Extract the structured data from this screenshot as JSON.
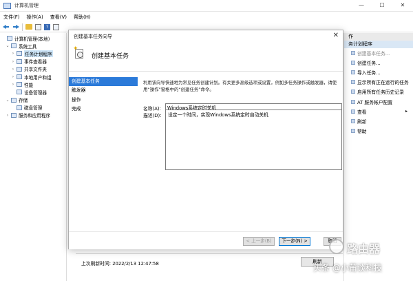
{
  "window": {
    "title": "计算机管理",
    "controls": [
      "—",
      "☐",
      "✕"
    ]
  },
  "menubar": [
    "文件(F)",
    "操作(A)",
    "查看(V)",
    "帮助(H)"
  ],
  "tree": [
    {
      "label": "计算机管理(本地)",
      "level": 0,
      "chev": ""
    },
    {
      "label": "系统工具",
      "level": 1,
      "chev": "⌄"
    },
    {
      "label": "任务计划程序",
      "level": 2,
      "chev": "›",
      "selected": true
    },
    {
      "label": "事件查看器",
      "level": 2,
      "chev": "›"
    },
    {
      "label": "共享文件夹",
      "level": 2,
      "chev": "›"
    },
    {
      "label": "本地用户和组",
      "level": 2,
      "chev": "›"
    },
    {
      "label": "性能",
      "level": 2,
      "chev": "›"
    },
    {
      "label": "设备管理器",
      "level": 2,
      "chev": ""
    },
    {
      "label": "存储",
      "level": 1,
      "chev": "⌄"
    },
    {
      "label": "磁盘管理",
      "level": 2,
      "chev": ""
    },
    {
      "label": "服务和应用程序",
      "level": 1,
      "chev": "›"
    }
  ],
  "actions": {
    "header": "作",
    "subheader": "务计划程序",
    "items": [
      {
        "label": "创建基本任务...",
        "disabled": true
      },
      {
        "label": "创建任务...",
        "disabled": false
      },
      {
        "label": "导入任务...",
        "disabled": false
      },
      {
        "label": "显示所有正在运行的任务",
        "disabled": false
      },
      {
        "label": "启用所有任务历史记录",
        "disabled": false
      },
      {
        "label": "AT 服务帐户配置",
        "disabled": false
      },
      {
        "label": "查看",
        "disabled": false,
        "submenu": "▸"
      },
      {
        "label": "刷新",
        "disabled": false
      },
      {
        "label": "帮助",
        "disabled": false
      }
    ]
  },
  "status": {
    "last_run": "上次刷新时间: 2022/2/13 12:47:58",
    "refresh_button": "刷新"
  },
  "dialog": {
    "title": "创建基本任务向导",
    "close": "✕",
    "heading": "创建基本任务",
    "steps": [
      "创建基本任务",
      "触发器",
      "操作",
      "完成"
    ],
    "intro": "利用该向导快速地为常见任务创建计划。有关更多高级选项或设置，例如多任务操作或触发器，请使用“操作”窗格中的“创建任务”命令。",
    "name_label": "名称(A):",
    "name_value": "Windows系统定时关机",
    "desc_label": "描述(D):",
    "desc_value": "设定一个时间，实现Windows系统定时自动关机",
    "buttons": {
      "back": "< 上一步(B)",
      "next": "下一步(N) >",
      "cancel": "取消"
    }
  },
  "watermark": {
    "logo_text": "路由器",
    "credit": "头条 @小莆谈科技"
  }
}
